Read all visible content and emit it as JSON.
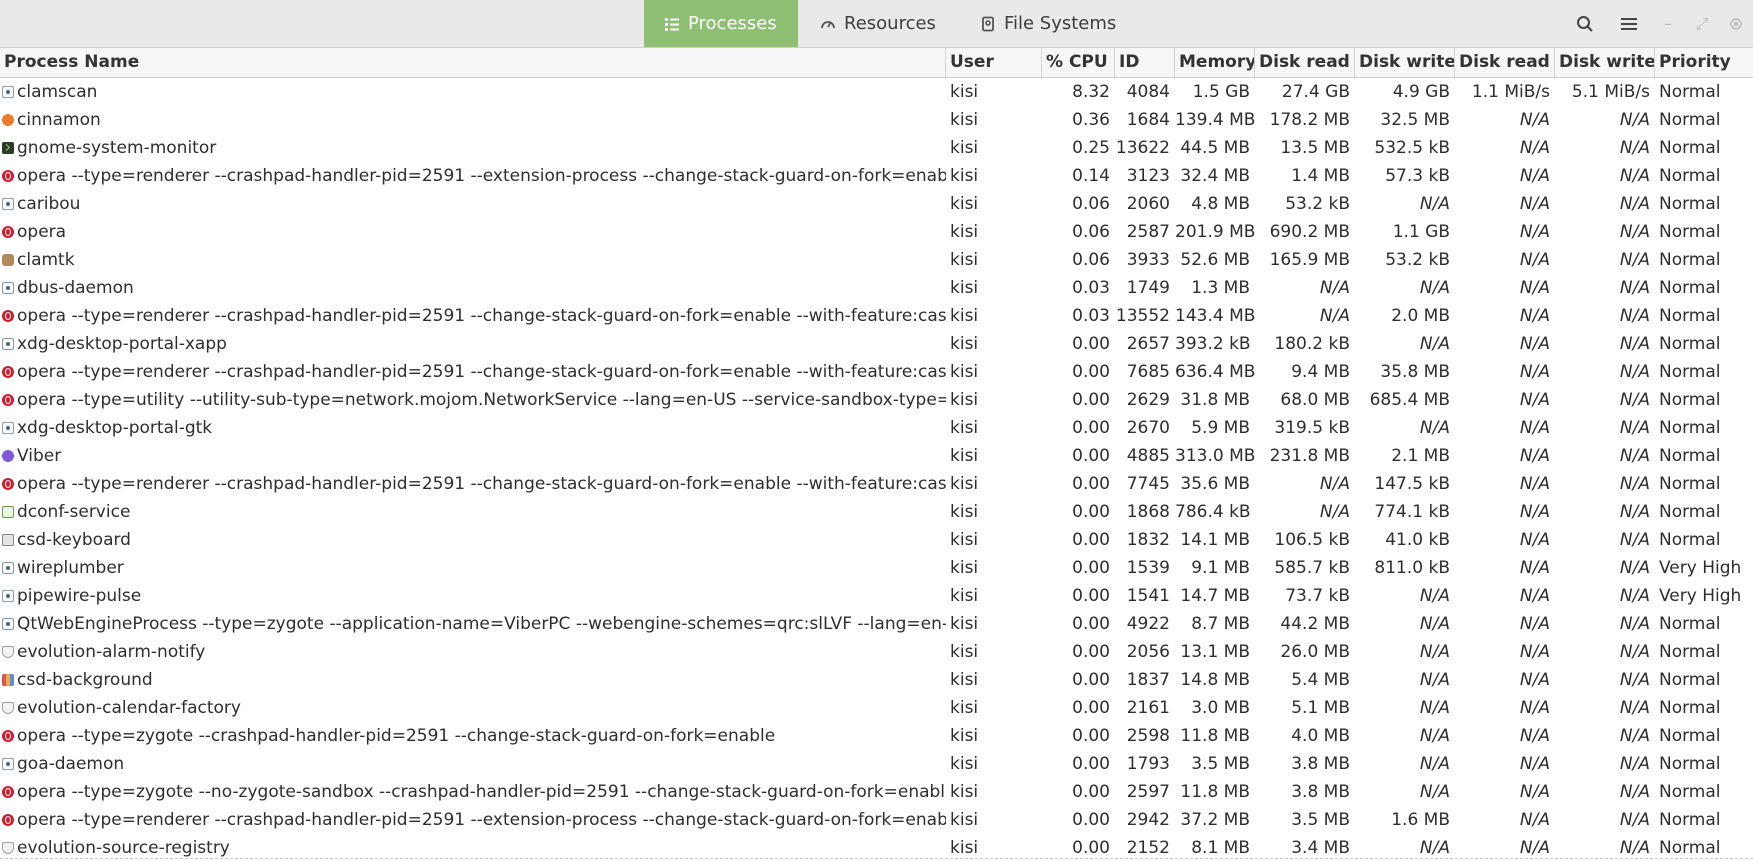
{
  "header": {
    "tabs": [
      {
        "label": "Processes",
        "icon": "list-icon",
        "active": true
      },
      {
        "label": "Resources",
        "icon": "gauge-icon",
        "active": false
      },
      {
        "label": "File Systems",
        "icon": "disk-icon",
        "active": false
      }
    ],
    "accent": "#8fbf73"
  },
  "columns": [
    "Process Name",
    "User",
    "% CPU",
    "ID",
    "Memory",
    "Disk read t",
    "Disk write",
    "Disk read",
    "Disk write",
    "Priority"
  ],
  "processes": [
    {
      "icon": "gear",
      "name": "clamscan",
      "user": "kisi",
      "cpu": "8.32",
      "id": "4084",
      "mem": "1.5 GB",
      "drt": "27.4 GB",
      "dwt": "4.9 GB",
      "dr": "1.1 MiB/s",
      "dw": "5.1 MiB/s",
      "pri": "Normal"
    },
    {
      "icon": "cinnamon",
      "name": "cinnamon",
      "user": "kisi",
      "cpu": "0.36",
      "id": "1684",
      "mem": "139.4 MB",
      "drt": "178.2 MB",
      "dwt": "32.5 MB",
      "dr": "N/A",
      "dw": "N/A",
      "pri": "Normal"
    },
    {
      "icon": "terminal",
      "name": "gnome-system-monitor",
      "user": "kisi",
      "cpu": "0.25",
      "id": "13622",
      "mem": "44.5 MB",
      "drt": "13.5 MB",
      "dwt": "532.5 kB",
      "dr": "N/A",
      "dw": "N/A",
      "pri": "Normal"
    },
    {
      "icon": "opera",
      "name": "opera --type=renderer --crashpad-handler-pid=2591 --extension-process --change-stack-guard-on-fork=enable --with-feature:cashback",
      "user": "kisi",
      "cpu": "0.14",
      "id": "3123",
      "mem": "32.4 MB",
      "drt": "1.4 MB",
      "dwt": "57.3 kB",
      "dr": "N/A",
      "dw": "N/A",
      "pri": "Normal"
    },
    {
      "icon": "gear",
      "name": "caribou",
      "user": "kisi",
      "cpu": "0.06",
      "id": "2060",
      "mem": "4.8 MB",
      "drt": "53.2 kB",
      "dwt": "N/A",
      "dr": "N/A",
      "dw": "N/A",
      "pri": "Normal"
    },
    {
      "icon": "opera",
      "name": "opera",
      "user": "kisi",
      "cpu": "0.06",
      "id": "2587",
      "mem": "201.9 MB",
      "drt": "690.2 MB",
      "dwt": "1.1 GB",
      "dr": "N/A",
      "dw": "N/A",
      "pri": "Normal"
    },
    {
      "icon": "clamtk",
      "name": "clamtk",
      "user": "kisi",
      "cpu": "0.06",
      "id": "3933",
      "mem": "52.6 MB",
      "drt": "165.9 MB",
      "dwt": "53.2 kB",
      "dr": "N/A",
      "dw": "N/A",
      "pri": "Normal"
    },
    {
      "icon": "gear",
      "name": "dbus-daemon",
      "user": "kisi",
      "cpu": "0.03",
      "id": "1749",
      "mem": "1.3 MB",
      "drt": "N/A",
      "dwt": "N/A",
      "dr": "N/A",
      "dw": "N/A",
      "pri": "Normal"
    },
    {
      "icon": "opera",
      "name": "opera --type=renderer --crashpad-handler-pid=2591 --change-stack-guard-on-fork=enable --with-feature:cashback",
      "user": "kisi",
      "cpu": "0.03",
      "id": "13552",
      "mem": "143.4 MB",
      "drt": "N/A",
      "dwt": "2.0 MB",
      "dr": "N/A",
      "dw": "N/A",
      "pri": "Normal"
    },
    {
      "icon": "gear",
      "name": "xdg-desktop-portal-xapp",
      "user": "kisi",
      "cpu": "0.00",
      "id": "2657",
      "mem": "393.2 kB",
      "drt": "180.2 kB",
      "dwt": "N/A",
      "dr": "N/A",
      "dw": "N/A",
      "pri": "Normal"
    },
    {
      "icon": "opera",
      "name": "opera --type=renderer --crashpad-handler-pid=2591 --change-stack-guard-on-fork=enable --with-feature:cashback",
      "user": "kisi",
      "cpu": "0.00",
      "id": "7685",
      "mem": "636.4 MB",
      "drt": "9.4 MB",
      "dwt": "35.8 MB",
      "dr": "N/A",
      "dw": "N/A",
      "pri": "Normal"
    },
    {
      "icon": "opera",
      "name": "opera --type=utility --utility-sub-type=network.mojom.NetworkService --lang=en-US --service-sandbox-type=none",
      "user": "kisi",
      "cpu": "0.00",
      "id": "2629",
      "mem": "31.8 MB",
      "drt": "68.0 MB",
      "dwt": "685.4 MB",
      "dr": "N/A",
      "dw": "N/A",
      "pri": "Normal"
    },
    {
      "icon": "gear",
      "name": "xdg-desktop-portal-gtk",
      "user": "kisi",
      "cpu": "0.00",
      "id": "2670",
      "mem": "5.9 MB",
      "drt": "319.5 kB",
      "dwt": "N/A",
      "dr": "N/A",
      "dw": "N/A",
      "pri": "Normal"
    },
    {
      "icon": "viber",
      "name": "Viber",
      "user": "kisi",
      "cpu": "0.00",
      "id": "4885",
      "mem": "313.0 MB",
      "drt": "231.8 MB",
      "dwt": "2.1 MB",
      "dr": "N/A",
      "dw": "N/A",
      "pri": "Normal"
    },
    {
      "icon": "opera",
      "name": "opera --type=renderer --crashpad-handler-pid=2591 --change-stack-guard-on-fork=enable --with-feature:cashback",
      "user": "kisi",
      "cpu": "0.00",
      "id": "7745",
      "mem": "35.6 MB",
      "drt": "N/A",
      "dwt": "147.5 kB",
      "dr": "N/A",
      "dw": "N/A",
      "pri": "Normal"
    },
    {
      "icon": "dconf",
      "name": "dconf-service",
      "user": "kisi",
      "cpu": "0.00",
      "id": "1868",
      "mem": "786.4 kB",
      "drt": "N/A",
      "dwt": "774.1 kB",
      "dr": "N/A",
      "dw": "N/A",
      "pri": "Normal"
    },
    {
      "icon": "keyboard",
      "name": "csd-keyboard",
      "user": "kisi",
      "cpu": "0.00",
      "id": "1832",
      "mem": "14.1 MB",
      "drt": "106.5 kB",
      "dwt": "41.0 kB",
      "dr": "N/A",
      "dw": "N/A",
      "pri": "Normal"
    },
    {
      "icon": "gear",
      "name": "wireplumber",
      "user": "kisi",
      "cpu": "0.00",
      "id": "1539",
      "mem": "9.1 MB",
      "drt": "585.7 kB",
      "dwt": "811.0 kB",
      "dr": "N/A",
      "dw": "N/A",
      "pri": "Very High"
    },
    {
      "icon": "gear",
      "name": "pipewire-pulse",
      "user": "kisi",
      "cpu": "0.00",
      "id": "1541",
      "mem": "14.7 MB",
      "drt": "73.7 kB",
      "dwt": "N/A",
      "dr": "N/A",
      "dw": "N/A",
      "pri": "Very High"
    },
    {
      "icon": "gear",
      "name": "QtWebEngineProcess --type=zygote --application-name=ViberPC --webengine-schemes=qrc:slLVF --lang=en-GB",
      "user": "kisi",
      "cpu": "0.00",
      "id": "4922",
      "mem": "8.7 MB",
      "drt": "44.2 MB",
      "dwt": "N/A",
      "dr": "N/A",
      "dw": "N/A",
      "pri": "Normal"
    },
    {
      "icon": "evo",
      "name": "evolution-alarm-notify",
      "user": "kisi",
      "cpu": "0.00",
      "id": "2056",
      "mem": "13.1 MB",
      "drt": "26.0 MB",
      "dwt": "N/A",
      "dr": "N/A",
      "dw": "N/A",
      "pri": "Normal"
    },
    {
      "icon": "bg",
      "name": "csd-background",
      "user": "kisi",
      "cpu": "0.00",
      "id": "1837",
      "mem": "14.8 MB",
      "drt": "5.4 MB",
      "dwt": "N/A",
      "dr": "N/A",
      "dw": "N/A",
      "pri": "Normal"
    },
    {
      "icon": "evo",
      "name": "evolution-calendar-factory",
      "user": "kisi",
      "cpu": "0.00",
      "id": "2161",
      "mem": "3.0 MB",
      "drt": "5.1 MB",
      "dwt": "N/A",
      "dr": "N/A",
      "dw": "N/A",
      "pri": "Normal"
    },
    {
      "icon": "opera",
      "name": "opera --type=zygote --crashpad-handler-pid=2591 --change-stack-guard-on-fork=enable",
      "user": "kisi",
      "cpu": "0.00",
      "id": "2598",
      "mem": "11.8 MB",
      "drt": "4.0 MB",
      "dwt": "N/A",
      "dr": "N/A",
      "dw": "N/A",
      "pri": "Normal"
    },
    {
      "icon": "gear",
      "name": "goa-daemon",
      "user": "kisi",
      "cpu": "0.00",
      "id": "1793",
      "mem": "3.5 MB",
      "drt": "3.8 MB",
      "dwt": "N/A",
      "dr": "N/A",
      "dw": "N/A",
      "pri": "Normal"
    },
    {
      "icon": "opera",
      "name": "opera --type=zygote --no-zygote-sandbox --crashpad-handler-pid=2591 --change-stack-guard-on-fork=enable",
      "user": "kisi",
      "cpu": "0.00",
      "id": "2597",
      "mem": "11.8 MB",
      "drt": "3.8 MB",
      "dwt": "N/A",
      "dr": "N/A",
      "dw": "N/A",
      "pri": "Normal"
    },
    {
      "icon": "opera",
      "name": "opera --type=renderer --crashpad-handler-pid=2591 --extension-process --change-stack-guard-on-fork=enable --with-feature:cashback",
      "user": "kisi",
      "cpu": "0.00",
      "id": "2942",
      "mem": "37.2 MB",
      "drt": "3.5 MB",
      "dwt": "1.6 MB",
      "dr": "N/A",
      "dw": "N/A",
      "pri": "Normal"
    },
    {
      "icon": "evo",
      "name": "evolution-source-registry",
      "user": "kisi",
      "cpu": "0.00",
      "id": "2152",
      "mem": "8.1 MB",
      "drt": "3.4 MB",
      "dwt": "N/A",
      "dr": "N/A",
      "dw": "N/A",
      "pri": "Normal"
    }
  ]
}
